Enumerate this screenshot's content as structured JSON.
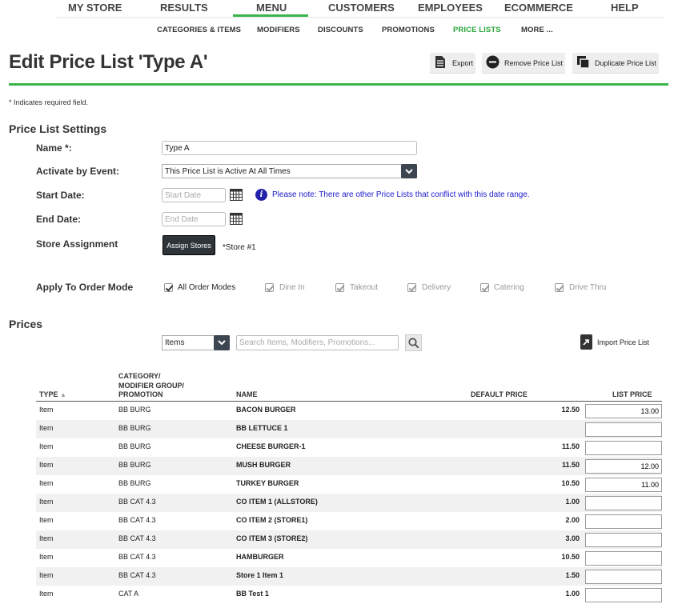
{
  "top_nav": {
    "items": [
      "MY STORE",
      "RESULTS",
      "MENU",
      "CUSTOMERS",
      "EMPLOYEES",
      "ECOMMERCE",
      "HELP"
    ],
    "active": "MENU"
  },
  "sub_nav": {
    "items": [
      "CATEGORIES & ITEMS",
      "MODIFIERS",
      "DISCOUNTS",
      "PROMOTIONS",
      "PRICE LISTS",
      "MORE ..."
    ],
    "active": "PRICE LISTS"
  },
  "page": {
    "title": "Edit Price List 'Type A'",
    "toolbar": {
      "export": "Export",
      "remove": "Remove Price List",
      "duplicate": "Duplicate Price List"
    },
    "required_note": "* Indicates required field."
  },
  "settings": {
    "heading": "Price List Settings",
    "name_label": "Name *:",
    "name_value": "Type A",
    "event_label": "Activate by Event:",
    "event_value": "This Price List is Active At All Times",
    "start_label": "Start Date:",
    "start_placeholder": "Start Date",
    "end_label": "End Date:",
    "end_placeholder": "End Date",
    "conflict_note": "Please note: There are other Price Lists that conflict with this date range.",
    "store_label": "Store Assignment",
    "assign_button": "Assign Stores",
    "assigned_store": "*Store #1",
    "order_mode_label": "Apply To Order Mode",
    "order_modes": [
      {
        "label": "All Order Modes",
        "checked": true,
        "disabled": false
      },
      {
        "label": "Dine In",
        "checked": true,
        "disabled": true
      },
      {
        "label": "Takeout",
        "checked": true,
        "disabled": true
      },
      {
        "label": "Delivery",
        "checked": true,
        "disabled": true
      },
      {
        "label": "Catering",
        "checked": true,
        "disabled": true
      },
      {
        "label": "Drive Thru",
        "checked": true,
        "disabled": true
      }
    ]
  },
  "prices": {
    "heading": "Prices",
    "filter_value": "Items",
    "search_placeholder": "Search Items, Modifiers, Promotions...",
    "import_label": "Import Price List",
    "columns": {
      "type": "TYPE",
      "category_1": "CATEGORY/",
      "category_2": "MODIFIER GROUP/",
      "category_3": "PROMOTION",
      "name": "NAME",
      "default_price": "DEFAULT PRICE",
      "list_price": "LIST PRICE"
    },
    "rows": [
      {
        "type": "Item",
        "category": "BB BURG",
        "name": "BACON BURGER",
        "default_price": "12.50",
        "list_price": "13.00"
      },
      {
        "type": "Item",
        "category": "BB BURG",
        "name": "BB LETTUCE 1",
        "default_price": "",
        "list_price": ""
      },
      {
        "type": "Item",
        "category": "BB BURG",
        "name": "CHEESE BURGER-1",
        "default_price": "11.50",
        "list_price": ""
      },
      {
        "type": "Item",
        "category": "BB BURG",
        "name": "MUSH BURGER",
        "default_price": "11.50",
        "list_price": "12.00"
      },
      {
        "type": "Item",
        "category": "BB BURG",
        "name": "TURKEY BURGER",
        "default_price": "10.50",
        "list_price": "11.00"
      },
      {
        "type": "Item",
        "category": "BB CAT 4.3",
        "name": "CO ITEM 1 (ALLSTORE)",
        "default_price": "1.00",
        "list_price": ""
      },
      {
        "type": "Item",
        "category": "BB CAT 4.3",
        "name": "CO ITEM 2 (STORE1)",
        "default_price": "2.00",
        "list_price": ""
      },
      {
        "type": "Item",
        "category": "BB CAT 4.3",
        "name": "CO ITEM 3 (STORE2)",
        "default_price": "3.00",
        "list_price": ""
      },
      {
        "type": "Item",
        "category": "BB CAT 4.3",
        "name": "HAMBURGER",
        "default_price": "10.50",
        "list_price": ""
      },
      {
        "type": "Item",
        "category": "BB CAT 4.3",
        "name": "Store 1 Item 1",
        "default_price": "1.50",
        "list_price": ""
      },
      {
        "type": "Item",
        "category": "CAT A",
        "name": "BB Test 1",
        "default_price": "1.00",
        "list_price": ""
      }
    ]
  },
  "colors": {
    "accent": "#39b54a",
    "dark": "#2f3439",
    "info": "#1a1acc"
  }
}
